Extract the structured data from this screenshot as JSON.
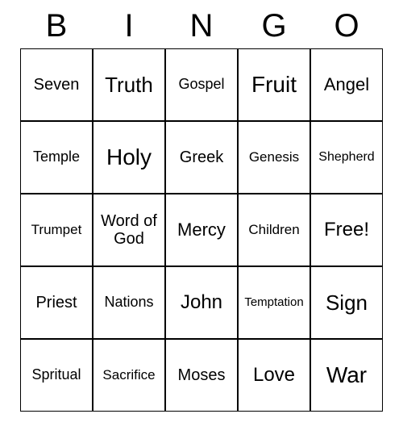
{
  "header": [
    "B",
    "I",
    "N",
    "G",
    "O"
  ],
  "cells": [
    {
      "text": "Seven",
      "size": "fs-20"
    },
    {
      "text": "Truth",
      "size": "fs-26"
    },
    {
      "text": "Gospel",
      "size": "fs-18"
    },
    {
      "text": "Fruit",
      "size": "fs-28"
    },
    {
      "text": "Angel",
      "size": "fs-22"
    },
    {
      "text": "Temple",
      "size": "fs-18"
    },
    {
      "text": "Holy",
      "size": "fs-28"
    },
    {
      "text": "Greek",
      "size": "fs-20"
    },
    {
      "text": "Genesis",
      "size": "fs-17"
    },
    {
      "text": "Shepherd",
      "size": "fs-16"
    },
    {
      "text": "Trumpet",
      "size": "fs-17"
    },
    {
      "text": "Word of God",
      "size": "fs-20"
    },
    {
      "text": "Mercy",
      "size": "fs-22"
    },
    {
      "text": "Children",
      "size": "fs-17"
    },
    {
      "text": "Free!",
      "size": "fs-24"
    },
    {
      "text": "Priest",
      "size": "fs-20"
    },
    {
      "text": "Nations",
      "size": "fs-18"
    },
    {
      "text": "John",
      "size": "fs-24"
    },
    {
      "text": "Temptation",
      "size": "fs-15"
    },
    {
      "text": "Sign",
      "size": "fs-26"
    },
    {
      "text": "Spritual",
      "size": "fs-18"
    },
    {
      "text": "Sacrifice",
      "size": "fs-17"
    },
    {
      "text": "Moses",
      "size": "fs-20"
    },
    {
      "text": "Love",
      "size": "fs-24"
    },
    {
      "text": "War",
      "size": "fs-28"
    }
  ]
}
